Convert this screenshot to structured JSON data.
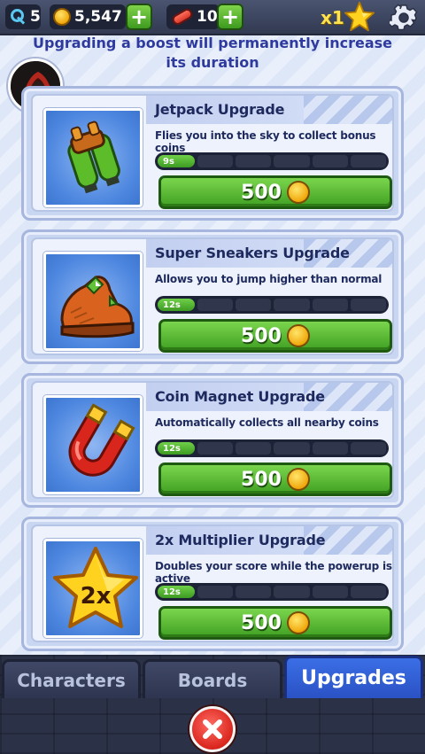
{
  "topbar": {
    "keys": "5",
    "coins": "5,547",
    "boards": "10",
    "plus_label": "+",
    "multiplier": "x1"
  },
  "info_text": "Upgrading a boost will permanently increase its duration",
  "cards": [
    {
      "title": "Jetpack Upgrade",
      "description": "Flies you into the sky to collect bonus coins",
      "duration": "9s",
      "price": "500",
      "icon": "jetpack-icon"
    },
    {
      "title": "Super Sneakers Upgrade",
      "description": "Allows you to jump higher than normal",
      "duration": "12s",
      "price": "500",
      "icon": "sneaker-icon"
    },
    {
      "title": "Coin Magnet Upgrade",
      "description": "Automatically collects all nearby coins",
      "duration": "12s",
      "price": "500",
      "icon": "magnet-icon"
    },
    {
      "title": "2x Multiplier Upgrade",
      "description": "Doubles your score while the powerup is active",
      "duration": "12s",
      "price": "500",
      "icon": "star-2x-icon",
      "icon_text": "2x"
    }
  ],
  "tabs": [
    {
      "label": "Characters",
      "active": false
    },
    {
      "label": "Boards",
      "active": false
    },
    {
      "label": "Upgrades",
      "active": true
    }
  ],
  "colors": {
    "accent_green": "#40a023",
    "info_blue": "#2e3a9e",
    "active_tab": "#2a52c4",
    "close_red": "#d9261d"
  }
}
